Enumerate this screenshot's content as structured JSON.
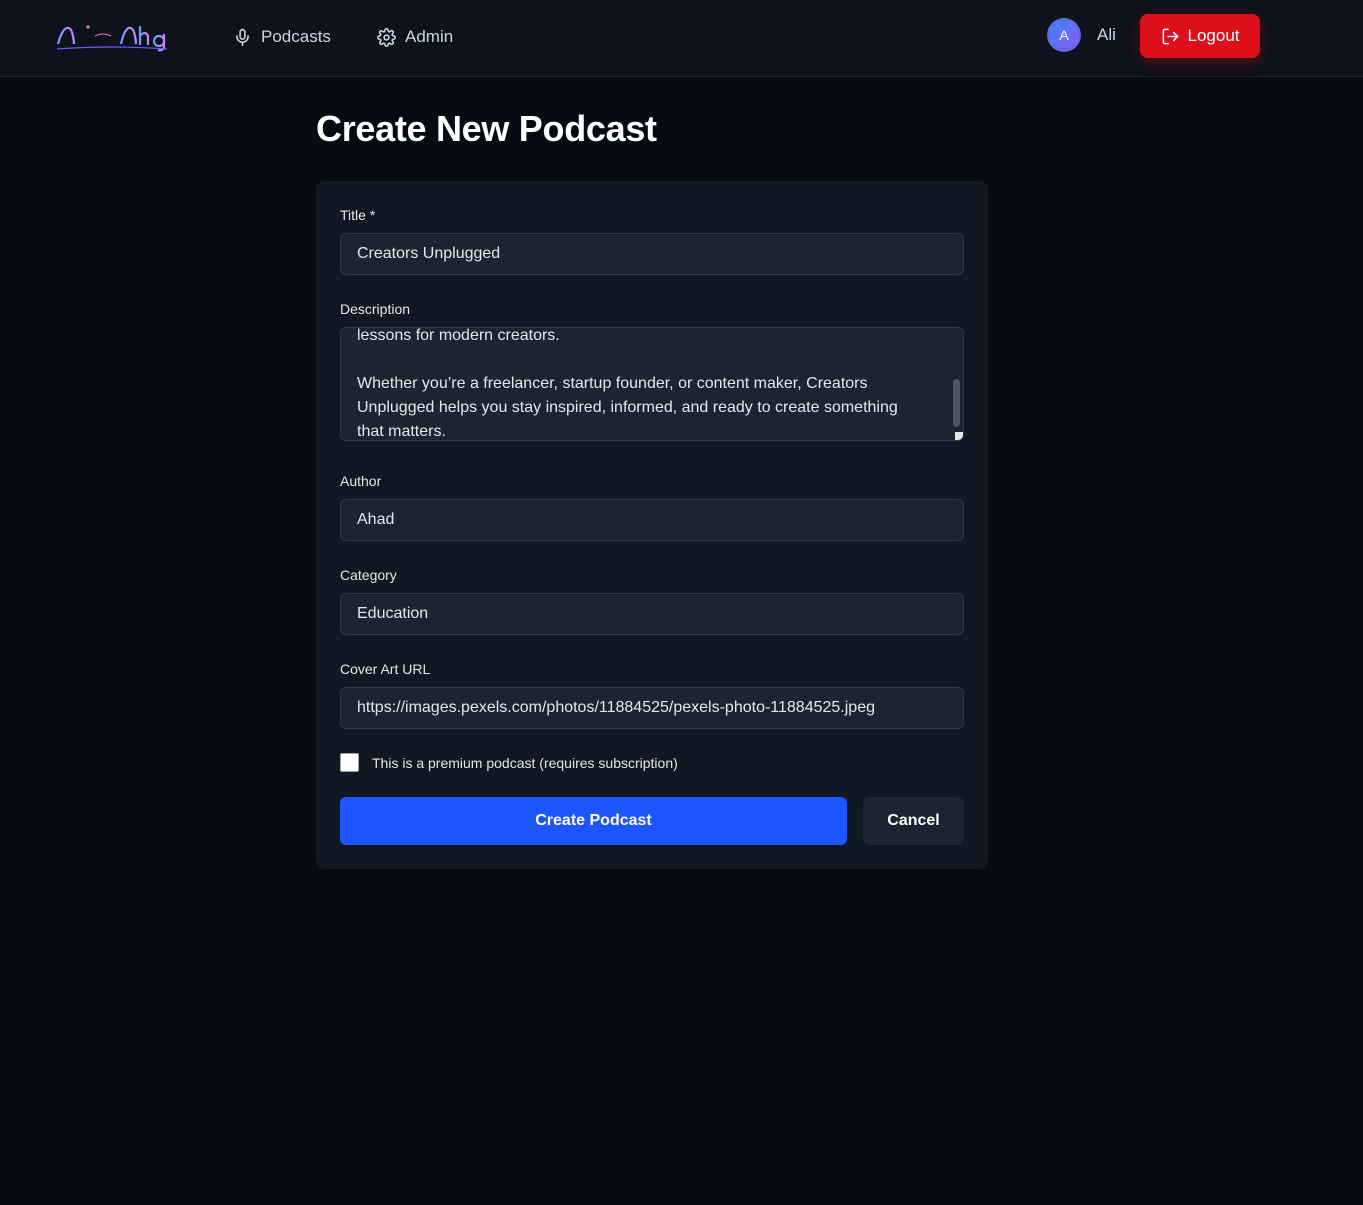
{
  "brand": {
    "logo_text": "Al Aha",
    "accent": "#dc0f1b",
    "primary": "#1d56ff"
  },
  "nav": {
    "links": [
      {
        "label": "Podcasts",
        "icon": "microphone-icon"
      },
      {
        "label": "Admin",
        "icon": "gear-icon"
      }
    ],
    "user": {
      "initial": "A",
      "name": "Ali"
    },
    "logout_label": "Logout"
  },
  "page": {
    "title": "Create New Podcast"
  },
  "form": {
    "title": {
      "label": "Title *",
      "value": "Creators Unplugged"
    },
    "description": {
      "label": "Description",
      "visible_lines": [
        "lessons for modern creators.",
        "",
        "Whether you’re a freelancer, startup founder, or content maker, Creators",
        "Unplugged helps you stay inspired, informed, and ready to create something",
        "that matters."
      ]
    },
    "author": {
      "label": "Author",
      "value": "Ahad"
    },
    "category": {
      "label": "Category",
      "value": "Education"
    },
    "cover_art": {
      "label": "Cover Art URL",
      "value": "https://images.pexels.com/photos/11884525/pexels-photo-11884525.jpeg"
    },
    "premium": {
      "label": "This is a premium podcast (requires subscription)",
      "checked": false
    },
    "submit_label": "Create Podcast",
    "cancel_label": "Cancel"
  }
}
